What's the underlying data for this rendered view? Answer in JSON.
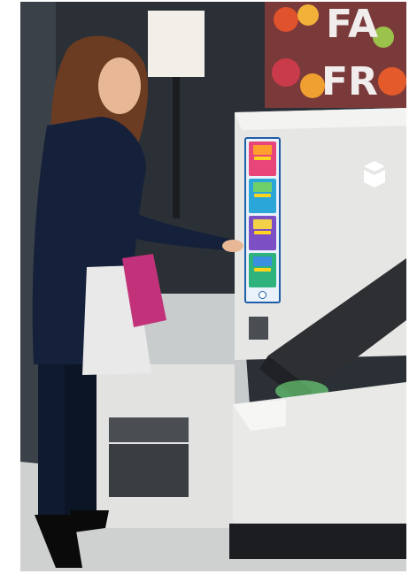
{
  "scene": {
    "store_sign": {
      "line1": "FA",
      "line2": "FR"
    },
    "kiosk": {
      "logo_icon": "cube-logo-icon",
      "screen_tiles": [
        {
          "title": "",
          "color": "#e8457a",
          "art": "#ff9f2e"
        },
        {
          "title": "",
          "color": "#2aa7d8",
          "art": "#6fd06a"
        },
        {
          "title": "",
          "color": "#7d4fc4",
          "art": "#f3d24a"
        },
        {
          "title": "",
          "color": "#2db37b",
          "art": "#3b8fe0"
        }
      ]
    },
    "colors": {
      "kiosk_body": "#e6e6e4",
      "kiosk_dark": "#2d2f33",
      "glow": "#7dff8a",
      "wall": "#2b3036",
      "floor": "#cfd0d0"
    }
  }
}
